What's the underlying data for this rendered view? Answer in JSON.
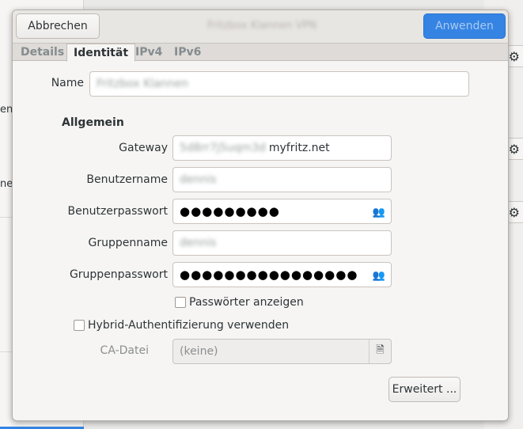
{
  "background": {
    "fragment_1": "en",
    "fragment_2": "ne"
  },
  "dialog": {
    "cancel_label": "Abbrechen",
    "apply_label": "Anwenden",
    "title": "Fritzbox Klannen VPN"
  },
  "tabs": [
    {
      "label": "Details"
    },
    {
      "label": "Identität"
    },
    {
      "label": "IPv4"
    },
    {
      "label": "IPv6"
    }
  ],
  "form": {
    "name_label": "Name",
    "name_value": "Fritzbox Klannen",
    "section_title": "Allgemein",
    "gateway_label": "Gateway",
    "gateway_prefix": "5d8rr7j5uqm3d",
    "gateway_suffix": "myfritz.net",
    "username_label": "Benutzername",
    "username_value": "dennis",
    "userpass_label": "Benutzerpasswort",
    "userpass_value": "●●●●●●●●●",
    "groupname_label": "Gruppenname",
    "groupname_value": "dennis",
    "grouppass_label": "Gruppenpasswort",
    "grouppass_value": "●●●●●●●●●●●●●●●●",
    "show_passwords_label": "Passwörter anzeigen",
    "hybrid_auth_label": "Hybrid-Authentifizierung verwenden",
    "ca_label": "CA-Datei",
    "ca_value": "(keine)",
    "advanced_label": "Erweitert ..."
  },
  "icons": {
    "password_storage": "people-icon",
    "file_chooser": "file-icon",
    "gear": "gear-icon"
  },
  "colors": {
    "accent": "#3584e4"
  }
}
